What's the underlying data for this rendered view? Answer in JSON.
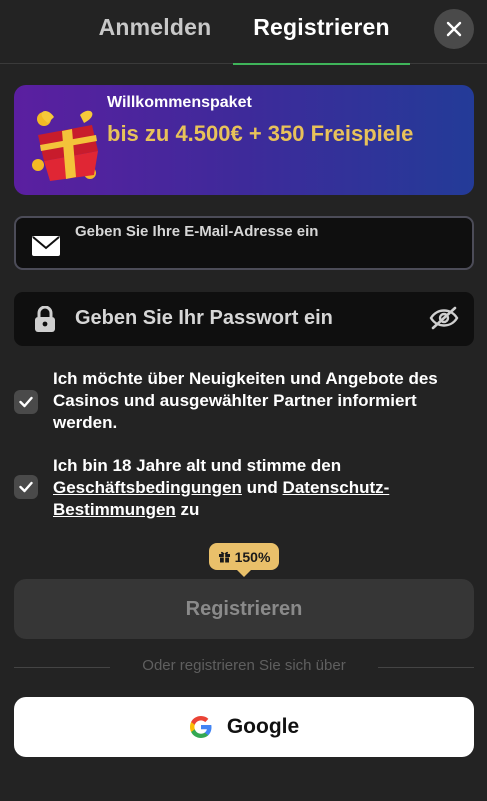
{
  "tabs": {
    "login_label": "Anmelden",
    "register_label": "Registrieren",
    "active": "register"
  },
  "banner": {
    "title": "Willkommenspaket",
    "offer": "bis zu 4.500€ + 350 Freispiele",
    "icon": "gift-icon"
  },
  "form": {
    "email_placeholder": "Geben Sie Ihre E-Mail-Adresse ein",
    "password_placeholder": "Geben Sie Ihr Passwort ein",
    "newsletter_label": "Ich möchte über Neuigkeiten und Angebote des Casinos und ausgewählter Partner informiert werden.",
    "newsletter_checked": true,
    "terms_prefix": "Ich bin 18 Jahre alt und stimme den",
    "terms_link": "Geschäftsbedingungen",
    "terms_and": "und",
    "privacy_link": "Datenschutz-Bestimmungen",
    "terms_suffix": "zu",
    "terms_checked": true
  },
  "bonus_badge": {
    "label": "150%",
    "icon": "gift-icon"
  },
  "actions": {
    "register_label": "Registrieren",
    "divider_text": "Oder registrieren Sie sich über",
    "google_label": "Google"
  },
  "colors": {
    "background": "#232323",
    "active_tab_underline": "#3fb55a",
    "offer_text": "#e8c25a",
    "badge": "#e9c06a"
  }
}
